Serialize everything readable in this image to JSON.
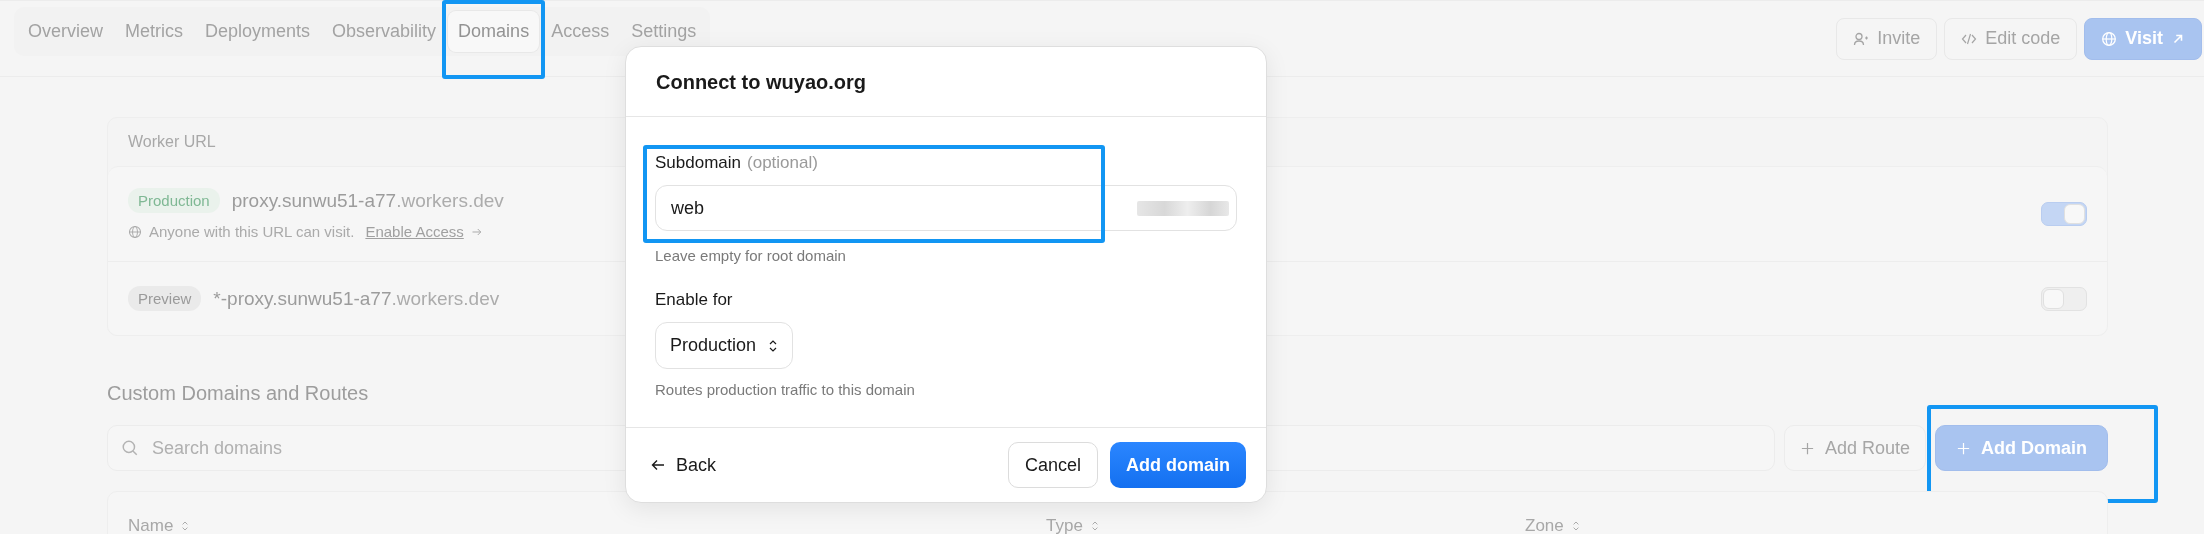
{
  "tabs": [
    {
      "label": "Overview",
      "selected": false,
      "highlighted": false
    },
    {
      "label": "Metrics",
      "selected": false,
      "highlighted": false
    },
    {
      "label": "Deployments",
      "selected": false,
      "highlighted": false
    },
    {
      "label": "Observability",
      "selected": false,
      "highlighted": false
    },
    {
      "label": "Domains",
      "selected": true,
      "highlighted": true
    },
    {
      "label": "Access",
      "selected": false,
      "highlighted": false
    },
    {
      "label": "Settings",
      "selected": false,
      "highlighted": false
    }
  ],
  "header_actions": [
    {
      "label": "Invite",
      "kind": "invite"
    },
    {
      "label": "Edit code",
      "kind": "code"
    },
    {
      "label": "Visit",
      "kind": "visit"
    }
  ],
  "worker_url": {
    "title": "Worker URL",
    "rows": [
      {
        "badge": "Production",
        "kind": "production",
        "host": "proxy.sunwu51-a77",
        "suffix": ".workers.dev",
        "on": true,
        "note": "Anyone with this URL can visit.",
        "link": "Enable Access"
      },
      {
        "badge": "Preview",
        "kind": "preview",
        "host": "*-proxy.sunwu51-a77",
        "suffix": ".workers.dev",
        "on": false
      }
    ]
  },
  "custom_domains": {
    "title": "Custom Domains and Routes",
    "search": {
      "placeholder": "Search domains"
    },
    "buttons": [
      {
        "label": "Add Route",
        "kind": "secondary",
        "highlighted": false
      },
      {
        "label": "Add Domain",
        "kind": "primary",
        "highlighted": true
      }
    ],
    "table": {
      "columns": [
        "Name",
        "Type",
        "Zone"
      ]
    }
  },
  "dialog": {
    "title": "Connect to wuyao.org",
    "subdomain": {
      "label": "Subdomain",
      "hint": "(optional)",
      "value": "web",
      "highlighted": true,
      "help": "Leave empty for root domain"
    },
    "enable_for": {
      "label": "Enable for",
      "value": "Production",
      "help": "Routes production traffic to this domain"
    },
    "back": "Back",
    "cancel": "Cancel",
    "submit": "Add domain"
  }
}
